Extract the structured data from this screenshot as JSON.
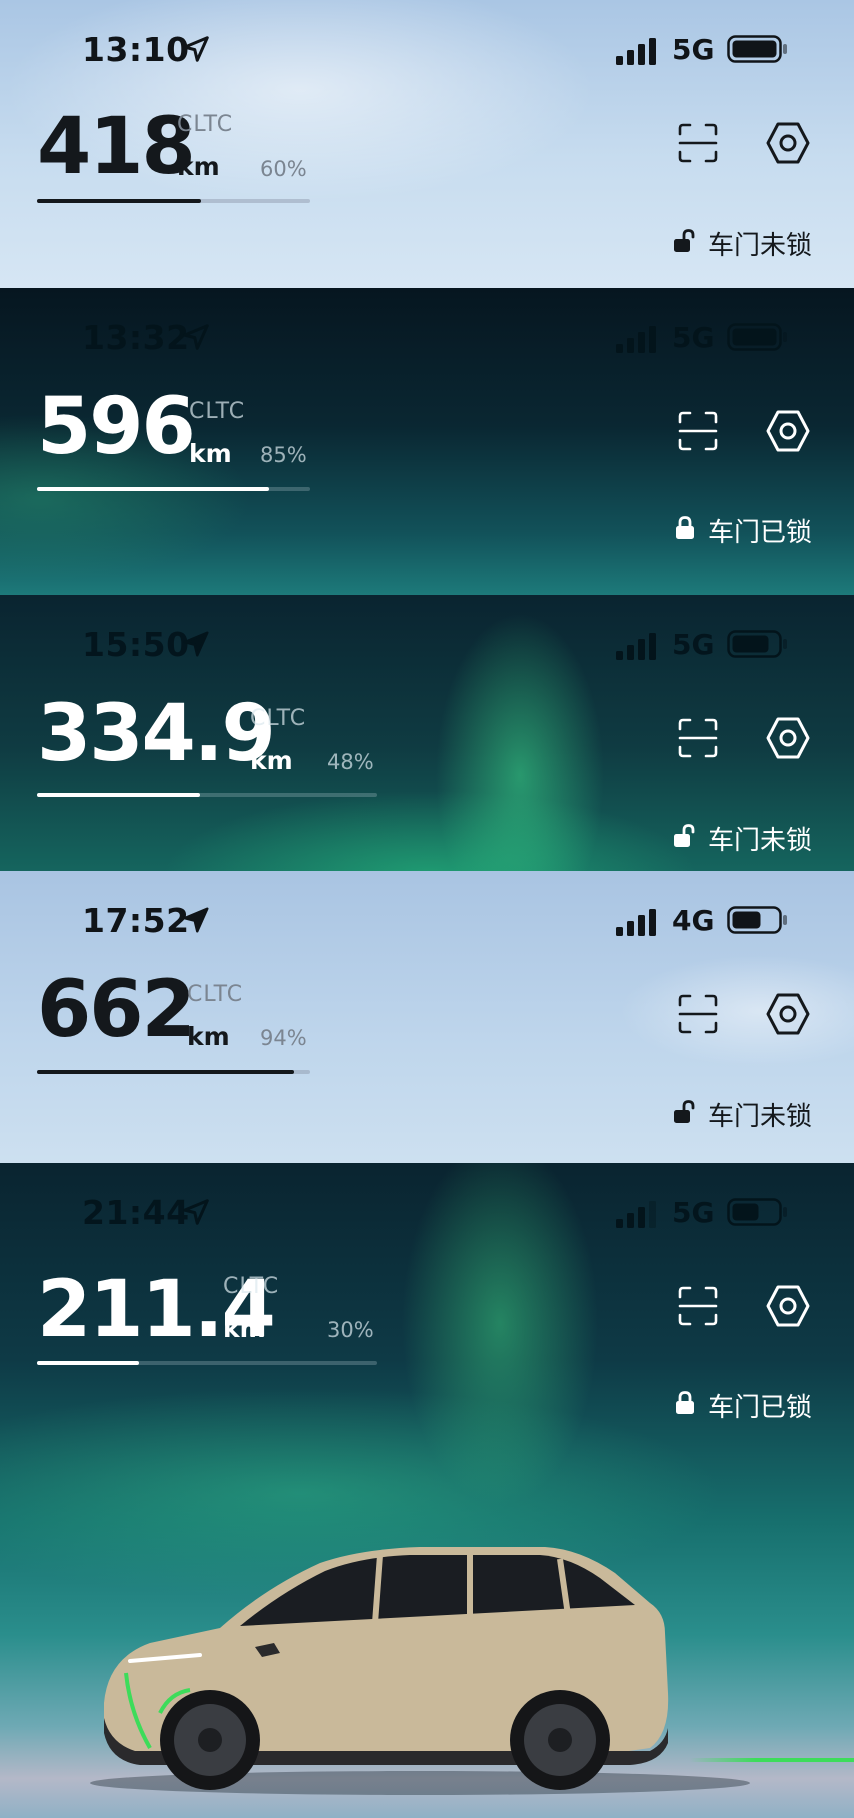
{
  "panels": [
    {
      "time": "13:10",
      "network": "5G",
      "range": "418",
      "standard": "CLTC",
      "unit": "km",
      "percent_label": "60%",
      "percent": 0.6,
      "lock_label": "车门未锁",
      "locked": false,
      "theme": "light"
    },
    {
      "time": "13:32",
      "network": "5G",
      "range": "596",
      "standard": "CLTC",
      "unit": "km",
      "percent_label": "85%",
      "percent": 0.85,
      "lock_label": "车门已锁",
      "locked": true,
      "theme": "dark"
    },
    {
      "time": "15:50",
      "network": "5G",
      "range": "334.9",
      "standard": "CLTC",
      "unit": "km",
      "percent_label": "48%",
      "percent": 0.48,
      "lock_label": "车门未锁",
      "locked": false,
      "theme": "dark"
    },
    {
      "time": "17:52",
      "network": "4G",
      "range": "662",
      "standard": "CLTC",
      "unit": "km",
      "percent_label": "94%",
      "percent": 0.94,
      "lock_label": "车门未锁",
      "locked": false,
      "theme": "light"
    },
    {
      "time": "21:44",
      "network": "5G",
      "range": "211.4",
      "standard": "CLTC",
      "unit": "km",
      "percent_label": "30%",
      "percent": 0.3,
      "lock_label": "车门已锁",
      "locked": true,
      "theme": "dark"
    }
  ],
  "icons": {
    "location": "location-arrow-icon",
    "signal": "cellular-signal-icon",
    "battery": "battery-icon",
    "scan": "scan-icon",
    "settings": "settings-hexagon-icon",
    "lock_open": "unlocked-padlock-icon",
    "lock_closed": "locked-padlock-icon"
  },
  "colors": {
    "charge_accent": "#3ddc5a",
    "car_body": "#c9b99a"
  }
}
